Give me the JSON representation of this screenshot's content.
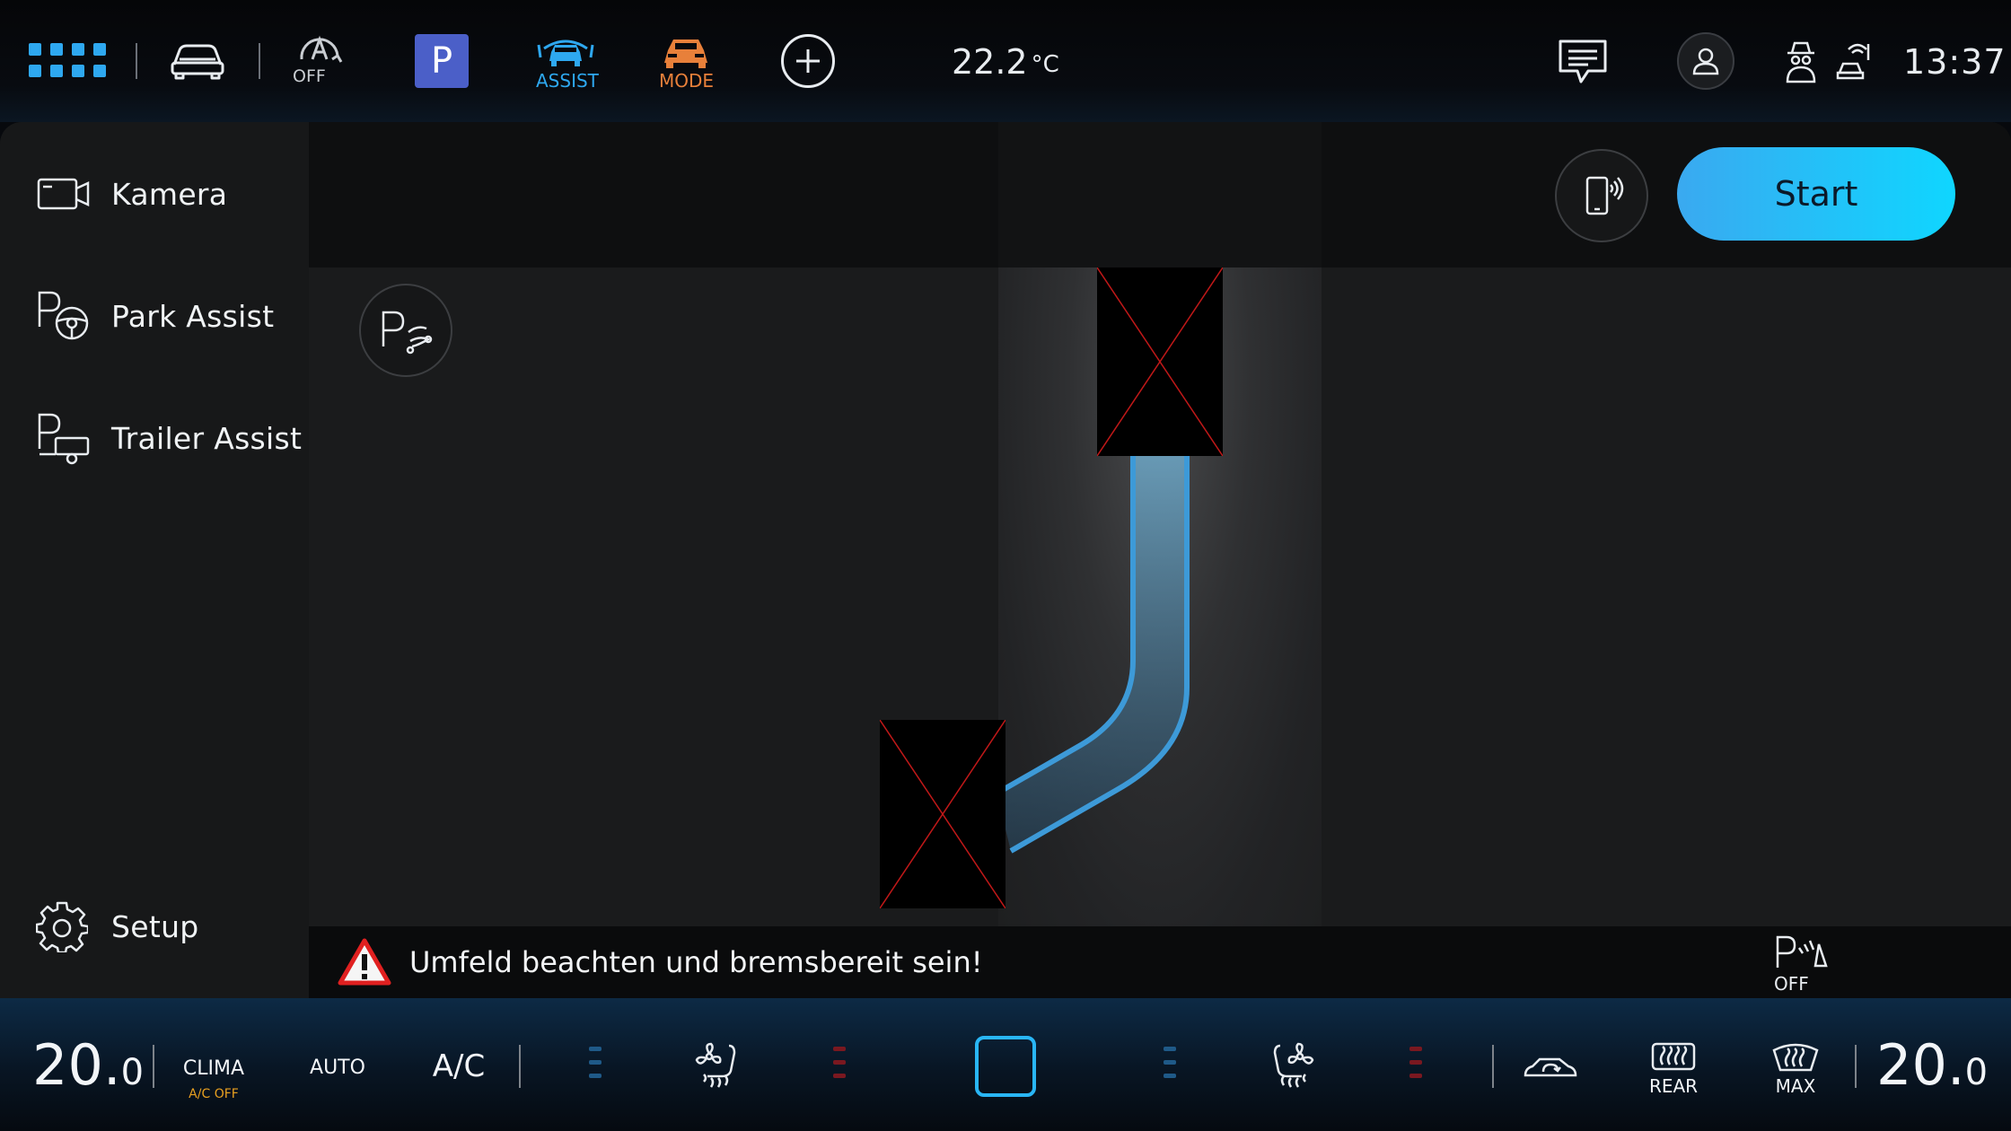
{
  "topbar": {
    "auto_hold_label": "OFF",
    "parking_label": "P",
    "assist_label": "ASSIST",
    "mode_label": "MODE",
    "outside_temp": "22.2",
    "outside_temp_unit": "°C",
    "clock": "13:37"
  },
  "sidebar": {
    "items": [
      {
        "label": "Kamera",
        "icon": "camera-icon"
      },
      {
        "label": "Park Assist",
        "icon": "park-assist-icon"
      },
      {
        "label": "Trailer Assist",
        "icon": "trailer-assist-icon"
      }
    ],
    "setup_label": "Setup"
  },
  "view": {
    "start_label": "Start",
    "parkpilot_off_label": "OFF",
    "warning_text": "Umfeld beachten und bremsbereit sein!"
  },
  "climate": {
    "left_temp_int": "20.",
    "left_temp_dec": "0",
    "right_temp_int": "20.",
    "right_temp_dec": "0",
    "clima_label": "CLIMA",
    "ac_off_label": "A/C OFF",
    "auto_label": "AUTO",
    "ac_label": "A/C",
    "rear_label": "REAR",
    "max_label": "MAX"
  },
  "colors": {
    "accent": "#2ea8f0",
    "start_gradient_end": "#0fd6ff",
    "mode_orange": "#e8803a",
    "parking_blue": "#4b5fc8",
    "ac_off_orange": "#e8a020",
    "warning_red": "#e02020",
    "heat_red": "#7a1820",
    "cool_blue": "#1f5a88"
  }
}
